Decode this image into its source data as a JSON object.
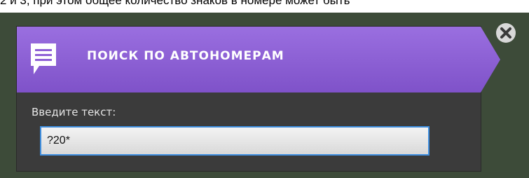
{
  "page_top_text": "2 и 3, при этом общее количество знаков в номере может быть",
  "dialog": {
    "title": "ПОИСК ПО АВТОНОМЕРАМ",
    "icon": "message-icon",
    "close_icon": "close-icon",
    "search_field": {
      "label": "Введите текст:",
      "value": "?20*"
    }
  },
  "colors": {
    "header_purple": "#8f61d6",
    "panel_dark": "#3b3b3b",
    "background_green": "#3d4b39",
    "input_border_blue": "#3f8fe0"
  }
}
